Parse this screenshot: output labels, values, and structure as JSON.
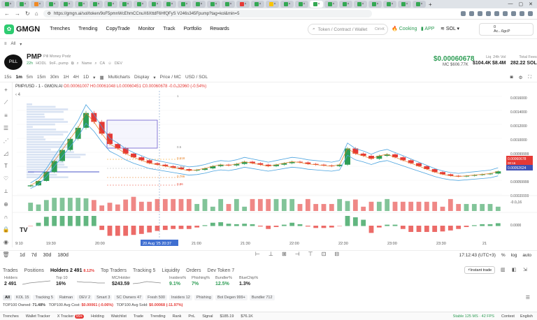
{
  "browser": {
    "url": "https://gmgn.ai/sol/token/9oF5pmnWcEhmCCnuX6XttdF6HfQFyS V246s345Fpump?tag=kol&min=5",
    "window_controls": [
      "—",
      "▢",
      "✕"
    ]
  },
  "nav": {
    "logo": "GMGN",
    "links": [
      "Trenches",
      "Trending",
      "CopyTrade",
      "Monitor",
      "Track",
      "Portfolio",
      "Rewards"
    ],
    "search_placeholder": "Token / Contract / Wallet",
    "search_shortcut": "Ctrl+K",
    "cooking": "Cooking",
    "app": "APP",
    "chain": "SOL",
    "wallet_balance": "0",
    "wallet_addr": "Ac...6gcP"
  },
  "filter": {
    "label": "All"
  },
  "token": {
    "symbol": "PMP",
    "name": "Pill Money Podz",
    "age": "22h",
    "tag": "HODL",
    "address": "9oF...pump",
    "links": [
      "Name",
      "CA",
      "DEV"
    ],
    "price": "$0.00060678",
    "mc_label": "MC",
    "mc": "$606.77K",
    "liq_label": "Liq",
    "liq": "$104.4K",
    "vol_label": "24h Vol",
    "vol": "$8.4M",
    "supply_label": "Total Fees",
    "supply": "282.22 SOL"
  },
  "chart_toolbar": {
    "intervals": [
      "15s",
      "1m",
      "5m",
      "15m",
      "30m",
      "1H",
      "4H",
      "1D"
    ],
    "selected_interval": "1m",
    "multicharts": "Multicharts",
    "display": "Display",
    "price_mc": "Price / MC",
    "currency": "USD / SOL"
  },
  "chart_header": {
    "title": "PMP/USD - 1 - GMGN.AI",
    "ohlc": "O0.00061007 H0.00061048 L0.00060451 C0.00060678 -0.0₅32960 (-0.54%)"
  },
  "chart_data": {
    "type": "line",
    "title": "PMP/USD - 1 - GMGN.AI",
    "y_ticks": [
      "0.0016000",
      "0.0014000",
      "0.0012000",
      "0.0010000",
      "0.00099999",
      "0.00079999",
      "0.00059999",
      "0.00039999"
    ],
    "x_ticks": [
      "9:10",
      "19:30",
      "20:00",
      "21:00",
      "21:30",
      "22:00",
      "22:30",
      "23:00",
      "23:30",
      "21"
    ],
    "fib_levels": [
      "1",
      "0.5",
      "0.618",
      "0.786",
      "0.786",
      "0.86"
    ],
    "price_label": "0.00060678",
    "price_label_sub": "00:16",
    "ma_label": "0.00052624",
    "vol_axis_label": "-0.0₂16",
    "macd_axis_label": "0.0000",
    "crosshair_time": "20 Aug '25  20:37",
    "ylim": [
      0.0003,
      0.0017
    ],
    "close": [
      0.00042,
      0.00048,
      0.0006,
      0.00075,
      0.0009,
      0.00105,
      0.0012,
      0.0014,
      0.00128,
      0.00112,
      0.00098,
      0.00092,
      0.00085,
      0.0008,
      0.00076,
      0.00072,
      0.0007,
      0.00068,
      0.00066,
      0.00064,
      0.00062,
      0.00063,
      0.00065,
      0.00068,
      0.0007,
      0.00069,
      0.00071,
      0.00074,
      0.00072,
      0.0007,
      0.00068,
      0.0007,
      0.00072,
      0.00074,
      0.00073,
      0.00071,
      0.0007,
      0.00069,
      0.00068,
      0.0007,
      0.00092,
      0.00085,
      0.00082,
      0.00078,
      0.00082,
      0.00084,
      0.0008,
      0.00076,
      0.00072,
      0.00068,
      0.00064,
      0.0006,
      0.00057,
      0.00055,
      0.00054,
      0.00055,
      0.00056,
      0.00057,
      0.00058,
      0.00061
    ]
  },
  "time_bar": {
    "ranges": [
      "1d",
      "7d",
      "30d",
      "180d"
    ],
    "clock": "17:12:43 (UTC+3)",
    "percent": "%",
    "log": "log",
    "auto": "auto"
  },
  "trades": {
    "tabs": [
      "Trades",
      "Positions",
      "Holders 2 491",
      "Top Traders",
      "Tracking 5",
      "Liquidity",
      "Orders",
      "Dev Token 7"
    ],
    "holders_delta": "8.12%",
    "instant_trade": "Instant trade"
  },
  "holder_stats": [
    {
      "label": "Holders",
      "value": "2 491"
    },
    {
      "label": "Top 10",
      "value": "16%"
    },
    {
      "label": "MC/Holder",
      "value": "$243.59"
    },
    {
      "label": "Insiders%",
      "value": "9.1%"
    },
    {
      "label": "Phishing%",
      "value": "7%"
    },
    {
      "label": "Bundler%",
      "value": "12.5%"
    },
    {
      "label": "BlueChip%",
      "value": "1.3%"
    }
  ],
  "filter_chips": [
    "All",
    "KOL 15",
    "Tracking 5",
    "Ratman",
    "DEV 2",
    "Smart 3",
    "SC Owners 47",
    "Fresh 500",
    "Insiders 12",
    "Phishing",
    "Bot Degen 999+",
    "Bundler 712"
  ],
  "top_row": {
    "t1": "TOP100 Owned:",
    "v1": "71.48%",
    "t2": "TOP100 Avg Cost:",
    "v2": "$0.00061 (-0.06%)",
    "t3": "TOP100 Avg Sold:",
    "v3": "$0.00068 (-11.97%)"
  },
  "footer": {
    "items": [
      "Trenches",
      "Wallet Tracker",
      "X Tracker",
      "Holding",
      "Watchlist",
      "Trade",
      "Trending",
      "Rank",
      "PnL",
      "Signal"
    ],
    "x_badge": "99+",
    "sol_price": "$185.19",
    "btc_price": "$76.1K",
    "stable": "Stable 125 MS · 42 FPS",
    "right": [
      "Contest",
      "English"
    ]
  },
  "colors": {
    "up": "#2e9d55",
    "down": "#e53935",
    "accent": "#2ecc71"
  }
}
